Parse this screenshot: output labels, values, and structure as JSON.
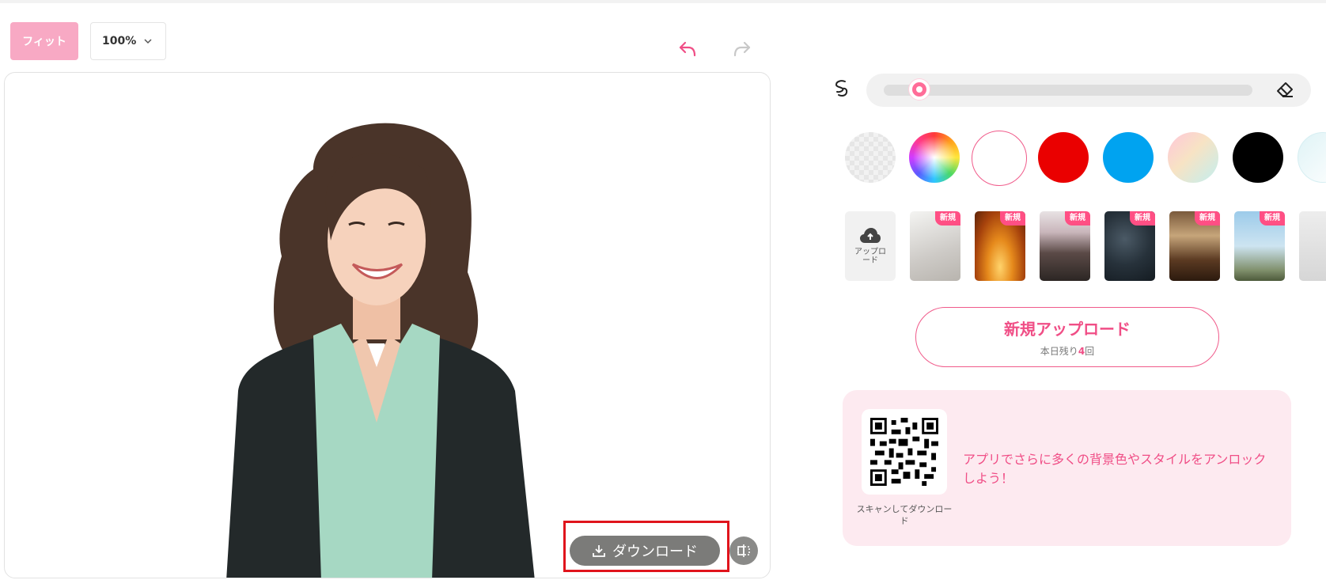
{
  "toolbar": {
    "fit_label": "フィット",
    "zoom_value": "100%"
  },
  "canvas": {
    "download_label": "ダウンロード"
  },
  "panel": {
    "brush_slider_value": 0.1,
    "swatches": [
      {
        "name": "transparent",
        "color": "transparent"
      },
      {
        "name": "color-picker",
        "color": "rainbow"
      },
      {
        "name": "white",
        "color": "#ffffff",
        "selected": true
      },
      {
        "name": "red",
        "color": "#ea0000"
      },
      {
        "name": "blue",
        "color": "#00a3f0"
      },
      {
        "name": "pastel-gradient",
        "color": "gradient"
      },
      {
        "name": "black",
        "color": "#000000"
      }
    ],
    "upload_tile_label": "アップロード",
    "thumbnails_badge": "新規",
    "thumbnails": [
      "light-wall",
      "autumn-forest",
      "pagoda",
      "dark-texture",
      "library",
      "eiffel-tower"
    ],
    "new_upload": {
      "title": "新規アップロード",
      "remaining_prefix": "本日残り",
      "remaining_count": "4",
      "remaining_suffix": "回"
    },
    "promo": {
      "qr_caption": "スキャンしてダウンロード",
      "text": "アプリでさらに多くの背景色やスタイルをアンロックしよう！"
    }
  },
  "colors": {
    "accent_pink": "#f04e86",
    "fit_button": "#f8a9c4",
    "highlight_red": "#e0141c",
    "promo_bg": "#fdeaf0"
  }
}
